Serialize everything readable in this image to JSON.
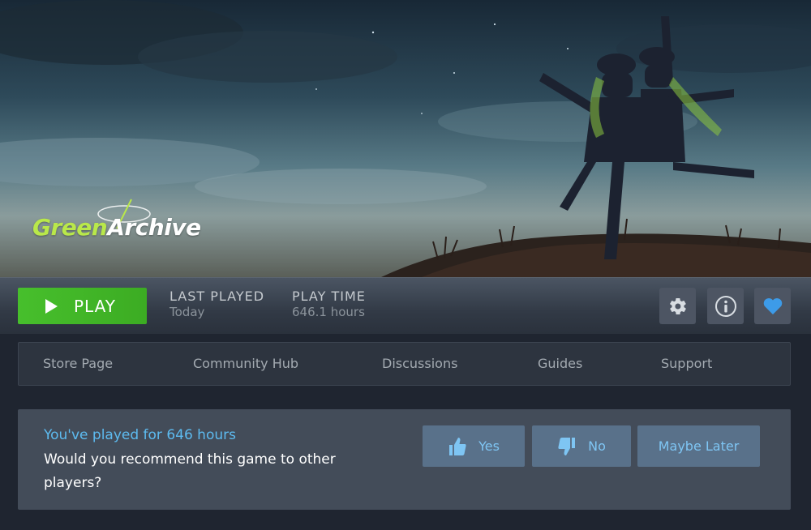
{
  "hero": {
    "logo_text_green": "Green",
    "logo_text_white": "Archive"
  },
  "action_bar": {
    "play_label": "PLAY",
    "last_played_label": "LAST PLAYED",
    "last_played_value": "Today",
    "play_time_label": "PLAY TIME",
    "play_time_value": "646.1 hours",
    "icons": [
      "gear-icon",
      "info-icon",
      "heart-icon"
    ]
  },
  "nav": {
    "store": "Store Page",
    "community": "Community Hub",
    "discussions": "Discussions",
    "guides": "Guides",
    "support": "Support"
  },
  "recommend": {
    "played_text": "You've played for 646 hours",
    "question": "Would you recommend this game to other players?",
    "yes": "Yes",
    "no": "No",
    "later": "Maybe Later"
  },
  "colors": {
    "play_green": "#47bf2c",
    "accent_blue": "#5dbbf0",
    "heart_blue": "#3d9be8"
  }
}
